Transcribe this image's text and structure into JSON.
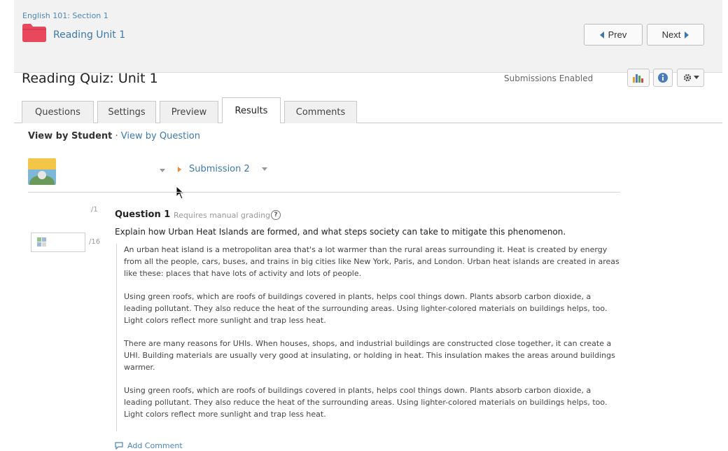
{
  "header": {
    "breadcrumb": "English 101: Section 1",
    "unit_title": "Reading Unit 1",
    "prev_label": "Prev",
    "next_label": "Next"
  },
  "quiz": {
    "title": "Reading Quiz: Unit 1",
    "status": "Submissions Enabled"
  },
  "toolbar": {
    "icons": [
      "bar-chart-icon",
      "info-icon",
      "gear-icon",
      "caret-down-icon"
    ]
  },
  "tabs": [
    {
      "label": "Questions",
      "active": false
    },
    {
      "label": "Settings",
      "active": false
    },
    {
      "label": "Preview",
      "active": false
    },
    {
      "label": "Results",
      "active": true
    },
    {
      "label": "Comments",
      "active": false
    }
  ],
  "view_by": {
    "current": "View by Student",
    "separator": "·",
    "alternate": "View by Question"
  },
  "student": {
    "submission_label": "Submission 2"
  },
  "question": {
    "points_max": "/1",
    "grade_max": "/16",
    "title_num": "Question 1",
    "note": "Requires manual grading",
    "help_glyph": "?",
    "prompt": "Explain how Urban Heat Islands are formed, and what steps society can take to mitigate this phenomenon.",
    "answer_paragraphs": [
      "An urban heat island is a metropolitan area that's a lot warmer than the rural areas surrounding it. Heat is created by energy from all the people, cars, buses, and trains in big cities like New York, Paris, and London. Urban heat islands are created in areas like these: places that have lots of activity and lots of people.",
      "Using green roofs, which are roofs of buildings covered in plants, helps cool things down. Plants absorb carbon dioxide, a leading pollutant. They also reduce the heat of the surrounding areas. Using lighter-colored materials on buildings helps, too. Light colors reflect more sunlight and trap less heat.",
      "There are many reasons for UHIs. When houses, shops, and industrial buildings are constructed close together, it can create a UHI. Building materials are usually very good at insulating, or holding in heat. This insulation makes the areas around buildings warmer.",
      "Using green roofs, which are roofs of buildings covered in plants, helps cool things down. Plants absorb carbon dioxide, a leading pollutant. They also reduce the heat of the surrounding areas. Using lighter-colored materials on buildings helps, too. Light colors reflect more sunlight and trap less heat."
    ],
    "add_comment": "Add Comment"
  },
  "colors": {
    "link": "#3b79ad",
    "folder": "#e8475c",
    "accent_orange": "#f0883a"
  }
}
